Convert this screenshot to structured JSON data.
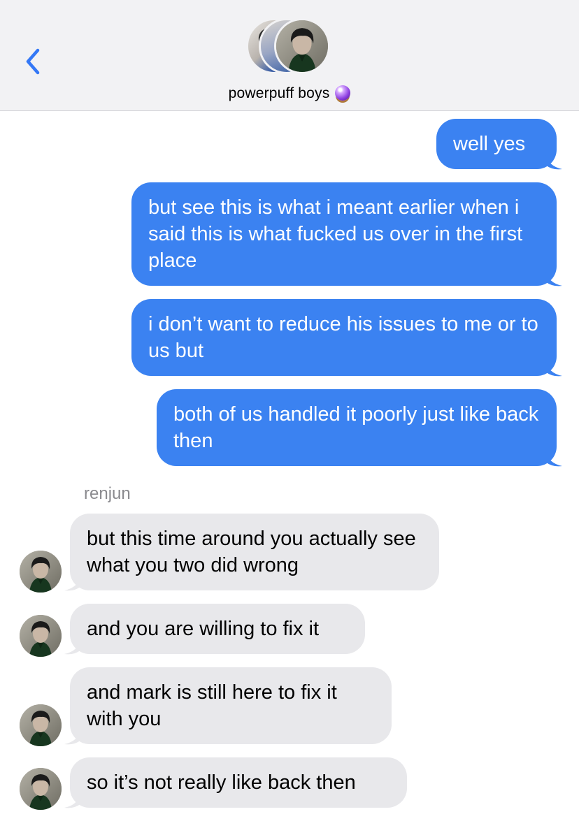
{
  "header": {
    "back_icon": "chevron-left-icon",
    "group_name": "powerpuff boys",
    "group_emoji": "crystal-ball-icon",
    "accent_color": "#3478f6"
  },
  "conversation": {
    "sender_name": "renjun",
    "outgoing_color": "#3b82f1",
    "incoming_color": "#e8e8eb",
    "outgoing": [
      {
        "text": "well yes"
      },
      {
        "text": "but see this is what i meant earlier when i said this is what fucked us over in the first place"
      },
      {
        "text": "i don’t want to reduce his issues to me or to us but"
      },
      {
        "text": "both of us handled it poorly just like back then"
      }
    ],
    "incoming": [
      {
        "text": "but this time around you actually see what you two did wrong"
      },
      {
        "text": "and you are willing to fix it"
      },
      {
        "text": "and mark is still here to fix it with you"
      },
      {
        "text": "so it’s not really like back then"
      }
    ]
  }
}
